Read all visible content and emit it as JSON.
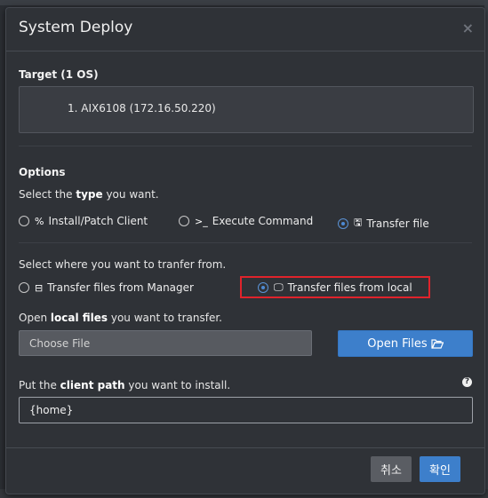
{
  "modal": {
    "title": "System Deploy",
    "close_glyph": "×"
  },
  "target": {
    "heading": "Target (1 OS)",
    "items": [
      "1. AIX6108 (172.16.50.220)"
    ]
  },
  "options": {
    "heading": "Options",
    "type_prompt": {
      "pre": "Select the ",
      "bold": "type",
      "post": " you want."
    },
    "type_choices": [
      {
        "label": "Install/Patch Client",
        "icon": "link-icon",
        "glyph": "%",
        "checked": false
      },
      {
        "label": "Execute Command",
        "icon": "terminal-icon",
        "glyph": ">_",
        "checked": false
      },
      {
        "label": "Transfer file",
        "icon": "floppy-disk-icon",
        "glyph": "🖫",
        "checked": true
      }
    ],
    "source_prompt": "Select where you want to tranfer from.",
    "source_choices": [
      {
        "label": "Transfer files from Manager",
        "icon": "server-icon",
        "glyph": "⊟",
        "checked": false
      },
      {
        "label": "Transfer files from local",
        "icon": "desktop-icon",
        "glyph": "🖵",
        "checked": true
      }
    ]
  },
  "local_files": {
    "prompt": {
      "pre": "Open ",
      "bold": "local files",
      "post": " you want to transfer."
    },
    "placeholder": "Choose File",
    "open_button": "Open Files",
    "open_icon": "folder-open-icon"
  },
  "client_path": {
    "prompt": {
      "pre": "Put the ",
      "bold": "client path",
      "post": " you want to install."
    },
    "value": "{home}",
    "help_glyph": "?"
  },
  "footer": {
    "cancel": "취소",
    "confirm": "확인"
  },
  "colors": {
    "accent": "#3d7fcb",
    "highlight": "#e0232b",
    "background": "#2f3237"
  }
}
